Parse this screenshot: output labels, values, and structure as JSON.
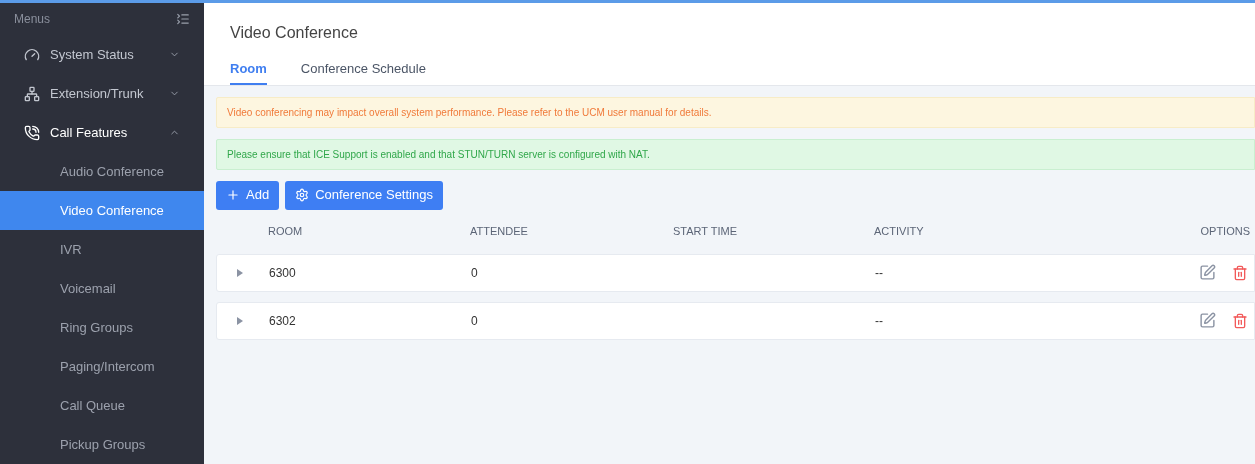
{
  "sidebar": {
    "title": "Menus",
    "items": [
      {
        "label": "System Status",
        "expanded": false
      },
      {
        "label": "Extension/Trunk",
        "expanded": false
      },
      {
        "label": "Call Features",
        "expanded": true,
        "children": [
          {
            "label": "Audio Conference",
            "selected": false
          },
          {
            "label": "Video Conference",
            "selected": true
          },
          {
            "label": "IVR",
            "selected": false
          },
          {
            "label": "Voicemail",
            "selected": false
          },
          {
            "label": "Ring Groups",
            "selected": false
          },
          {
            "label": "Paging/Intercom",
            "selected": false
          },
          {
            "label": "Call Queue",
            "selected": false
          },
          {
            "label": "Pickup Groups",
            "selected": false
          }
        ]
      }
    ]
  },
  "page": {
    "title": "Video Conference",
    "tabs": [
      {
        "label": "Room",
        "selected": true
      },
      {
        "label": "Conference Schedule",
        "selected": false
      }
    ],
    "alerts": [
      {
        "kind": "warning",
        "text": "Video conferencing may impact overall system performance. Please refer to the UCM user manual for details."
      },
      {
        "kind": "success",
        "text": "Please ensure that ICE Support is enabled and that STUN/TURN server is configured with NAT."
      }
    ],
    "buttons": [
      {
        "label": "Add"
      },
      {
        "label": "Conference Settings"
      }
    ],
    "table": {
      "columns": [
        "ROOM",
        "ATTENDEE",
        "START TIME",
        "ACTIVITY",
        "OPTIONS"
      ],
      "rows": [
        {
          "room": "6300",
          "attendee": "0",
          "activity": "--",
          "expanded": false
        },
        {
          "room": "6302",
          "attendee": "0",
          "activity": "--",
          "expanded": false
        }
      ]
    }
  }
}
